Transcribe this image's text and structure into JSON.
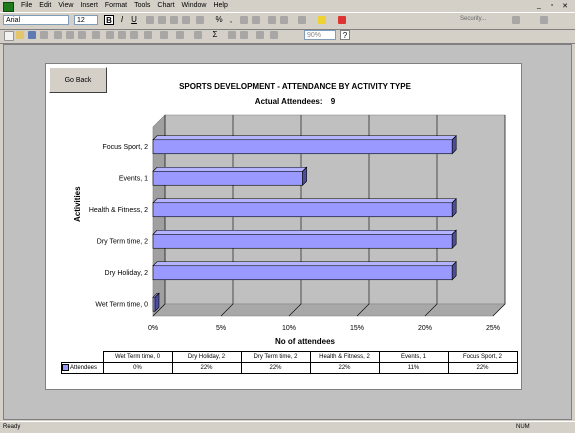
{
  "menu": {
    "items": [
      "File",
      "Edit",
      "View",
      "Insert",
      "Format",
      "Tools",
      "Chart",
      "Window",
      "Help"
    ],
    "controls": [
      "_",
      "▫",
      "✕"
    ]
  },
  "toolbar": {
    "font": "Arial",
    "size": "12",
    "bold": "B",
    "italic": "I",
    "underline": "U",
    "percent": "%",
    "comma": ",",
    "sigma": "Σ",
    "zoom": "90%",
    "help": "?",
    "security": "Security..."
  },
  "button": {
    "go_back": "Go Back"
  },
  "chart": {
    "title": "SPORTS DEVELOPMENT - ATTENDANCE BY ACTIVITY TYPE",
    "subtitle_label": "Actual Attendees:",
    "subtitle_value": "9",
    "ylabel": "Activities",
    "xlabel": "No of attendees"
  },
  "chart_data": {
    "type": "bar",
    "orientation": "horizontal",
    "title": "SPORTS DEVELOPMENT - ATTENDANCE BY ACTIVITY TYPE",
    "xlabel": "No of attendees",
    "ylabel": "Activities",
    "categories": [
      "Wet Term time, 0",
      "Dry Holiday, 2",
      "Dry Term time, 2",
      "Health & Fitness, 2",
      "Events, 1",
      "Focus Sport, 2"
    ],
    "series": [
      {
        "name": "Attendees",
        "values": [
          0,
          22,
          22,
          22,
          11,
          22
        ]
      }
    ],
    "xlim": [
      0,
      25
    ],
    "ticks": [
      "0%",
      "5%",
      "10%",
      "15%",
      "20%",
      "25%"
    ],
    "table_values": [
      "0%",
      "22%",
      "22%",
      "22%",
      "11%",
      "22%"
    ],
    "bar_color": "#9999ff",
    "grid": true,
    "data_table": true
  },
  "status": {
    "left": "Ready",
    "right": "NUM"
  }
}
